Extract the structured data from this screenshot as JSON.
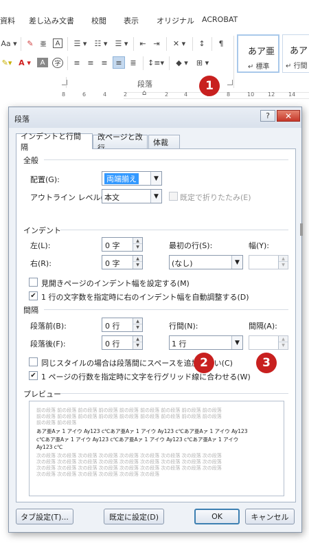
{
  "ribbon": {
    "tabs": [
      "資料",
      "差し込み文書",
      "校閲",
      "表示",
      "オリジナル",
      "ACROBAT"
    ],
    "group_label": "段落",
    "styles": [
      {
        "sample": "あア亜",
        "label": "標準"
      },
      {
        "sample": "あア",
        "label": "行間"
      }
    ],
    "ruler_ticks": [
      "8",
      "6",
      "4",
      "2",
      "2",
      "4",
      "6",
      "8",
      "10",
      "12",
      "14"
    ]
  },
  "badges": {
    "one": "1",
    "two": "2",
    "three": "3"
  },
  "dialog": {
    "title": "段落",
    "help": "?",
    "close": "✕",
    "tabs": [
      "インデントと行間隔",
      "改ページと改行",
      "体裁"
    ],
    "general": {
      "heading": "全般",
      "alignment_label": "配置(G):",
      "alignment_value": "両端揃え",
      "outline_label": "アウトライン レベル(O):",
      "outline_value": "本文",
      "collapse_label": "既定で折りたたみ(E)"
    },
    "indent": {
      "heading": "インデント",
      "left_label": "左(L):",
      "left_value": "0 字",
      "right_label": "右(R):",
      "right_value": "0 字",
      "first_line_label": "最初の行(S):",
      "first_line_value": "(なし)",
      "width_label": "幅(Y):",
      "mirror_label": "見開きページのインデント幅を設定する(M)",
      "auto_adjust_label": "1 行の文字数を指定時に右のインデント幅を自動調整する(D)"
    },
    "spacing": {
      "heading": "間隔",
      "before_label": "段落前(B):",
      "before_value": "0 行",
      "after_label": "段落後(F):",
      "after_value": "0 行",
      "line_spacing_label": "行間(N):",
      "line_spacing_value": "1 行",
      "at_label": "間隔(A):",
      "no_space_label": "同じスタイルの場合は段落間にスペースを追加しない(C)",
      "snap_grid_label": "1 ページの行数を指定時に文字を行グリッド線に合わせる(W)"
    },
    "preview": {
      "heading": "プレビュー",
      "prev_lines": [
        "前の段落 前の段落 前の段落 前の段落 前の段落 前の段落 前の段落 前の段落 前の段落",
        "前の段落 前の段落 前の段落 前の段落 前の段落 前の段落 前の段落 前の段落 前の段落",
        "前の段落 前の段落"
      ],
      "sample_lines": [
        "あア亜Aァ 1 アイウ Ay123 c℃あア亜Aァ 1 アイウ Ay123 c℃あア亜Aァ 1 アイウ Ay123",
        "c℃あア亜Aァ 1 アイウ Ay123 c℃あア亜Aァ 1 アイウ Ay123 c℃あア亜Aァ 1 アイウ",
        "Ay123 c℃"
      ],
      "next_lines": [
        "次の段落 次の段落 次の段落 次の段落 次の段落 次の段落 次の段落 次の段落 次の段落",
        "次の段落 次の段落 次の段落 次の段落 次の段落 次の段落 次の段落 次の段落 次の段落",
        "次の段落 次の段落 次の段落 次の段落 次の段落 次の段落 次の段落 次の段落 次の段落",
        "次の段落 次の段落 次の段落 次の段落 次の段落 次の段落"
      ]
    },
    "buttons": {
      "tabs": "タブ設定(T)...",
      "set_default": "既定に設定(D)",
      "ok": "OK",
      "cancel": "キャンセル"
    }
  },
  "colors": {
    "badge": "#c8201f",
    "selection": "#3399ff",
    "close": "#c6382a"
  }
}
